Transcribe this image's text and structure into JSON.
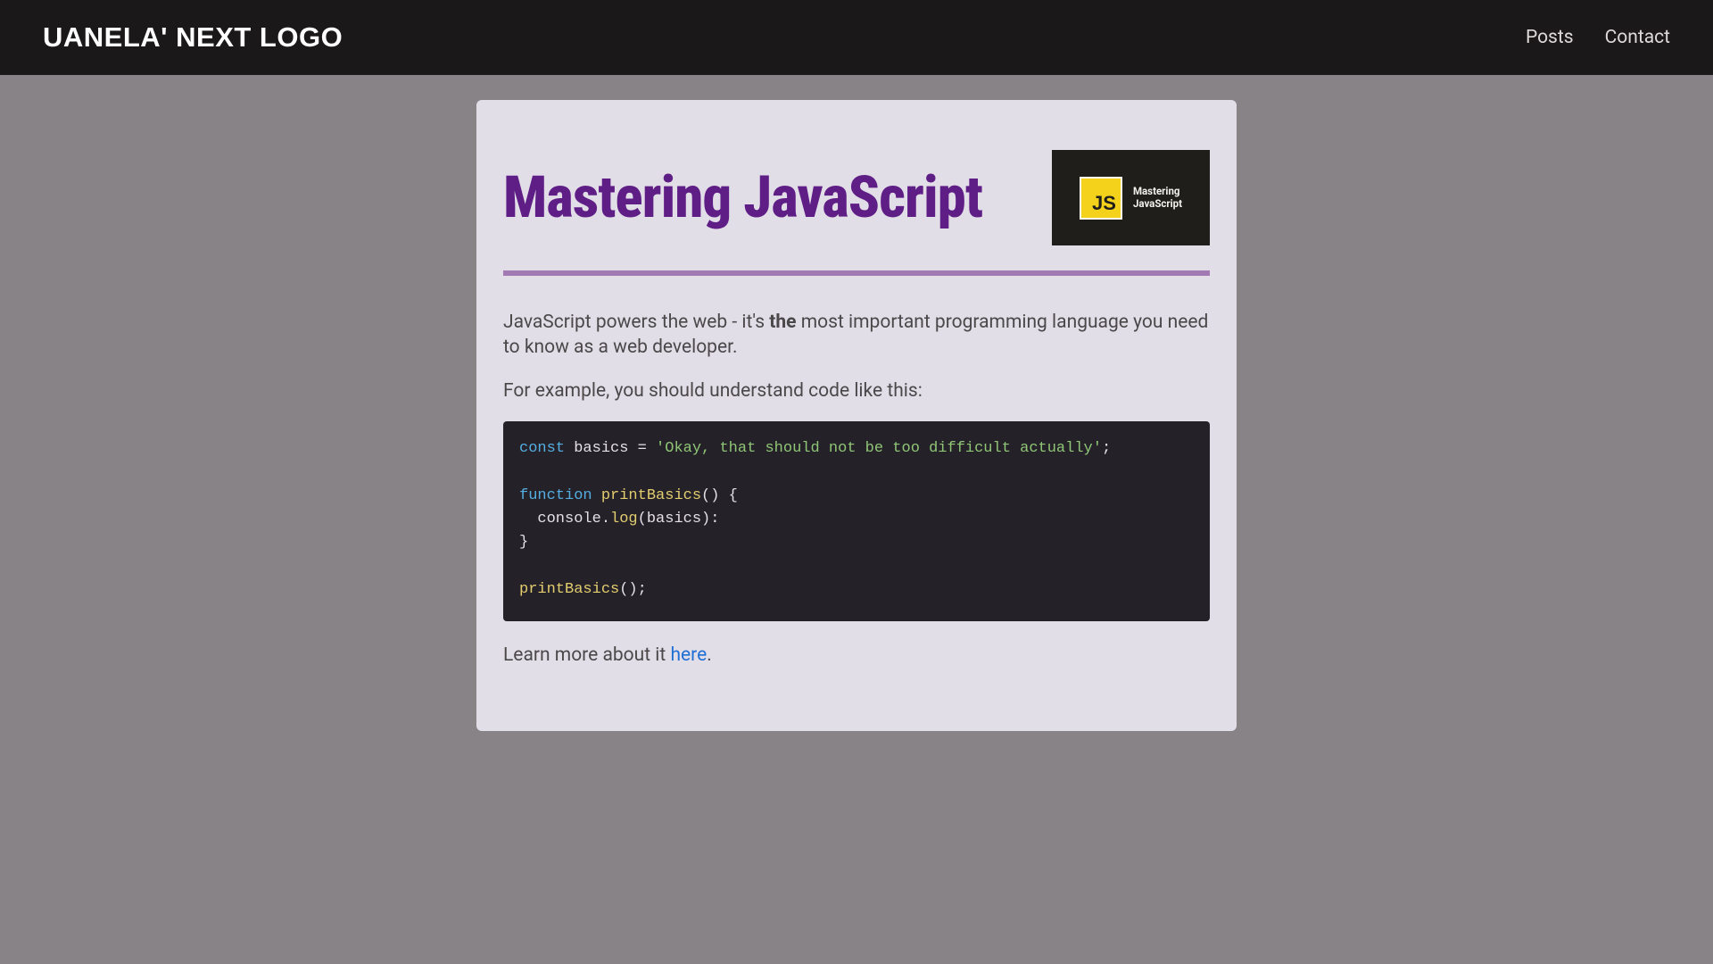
{
  "header": {
    "logo": "UANELA' NEXT LOGO",
    "nav": {
      "posts": "Posts",
      "contact": "Contact"
    }
  },
  "article": {
    "title": "Mastering JavaScript",
    "thumb": {
      "badge": "JS",
      "line1": "Mastering",
      "line2": "JavaScript"
    },
    "p1_pre": "JavaScript powers the web - it's ",
    "p1_strong": "the",
    "p1_post": " most important programming language you need to know as a web developer.",
    "p2": "For example, you should understand code like this:",
    "code": {
      "l1_kw": "const",
      "l1_id": " basics ",
      "l1_op": "= ",
      "l1_str": "'Okay, that should not be too difficult actually'",
      "l1_end": ";",
      "l3_kw": "function",
      "l3_sp": " ",
      "l3_fn": "printBasics",
      "l3_paren": "() {",
      "l4_pre": "  console.",
      "l4_fn": "log",
      "l4_post": "(basics):",
      "l5": "}",
      "l7_fn": "printBasics",
      "l7_post": "();"
    },
    "p3_pre": "Learn more about it ",
    "p3_link": "here",
    "p3_post": "."
  }
}
